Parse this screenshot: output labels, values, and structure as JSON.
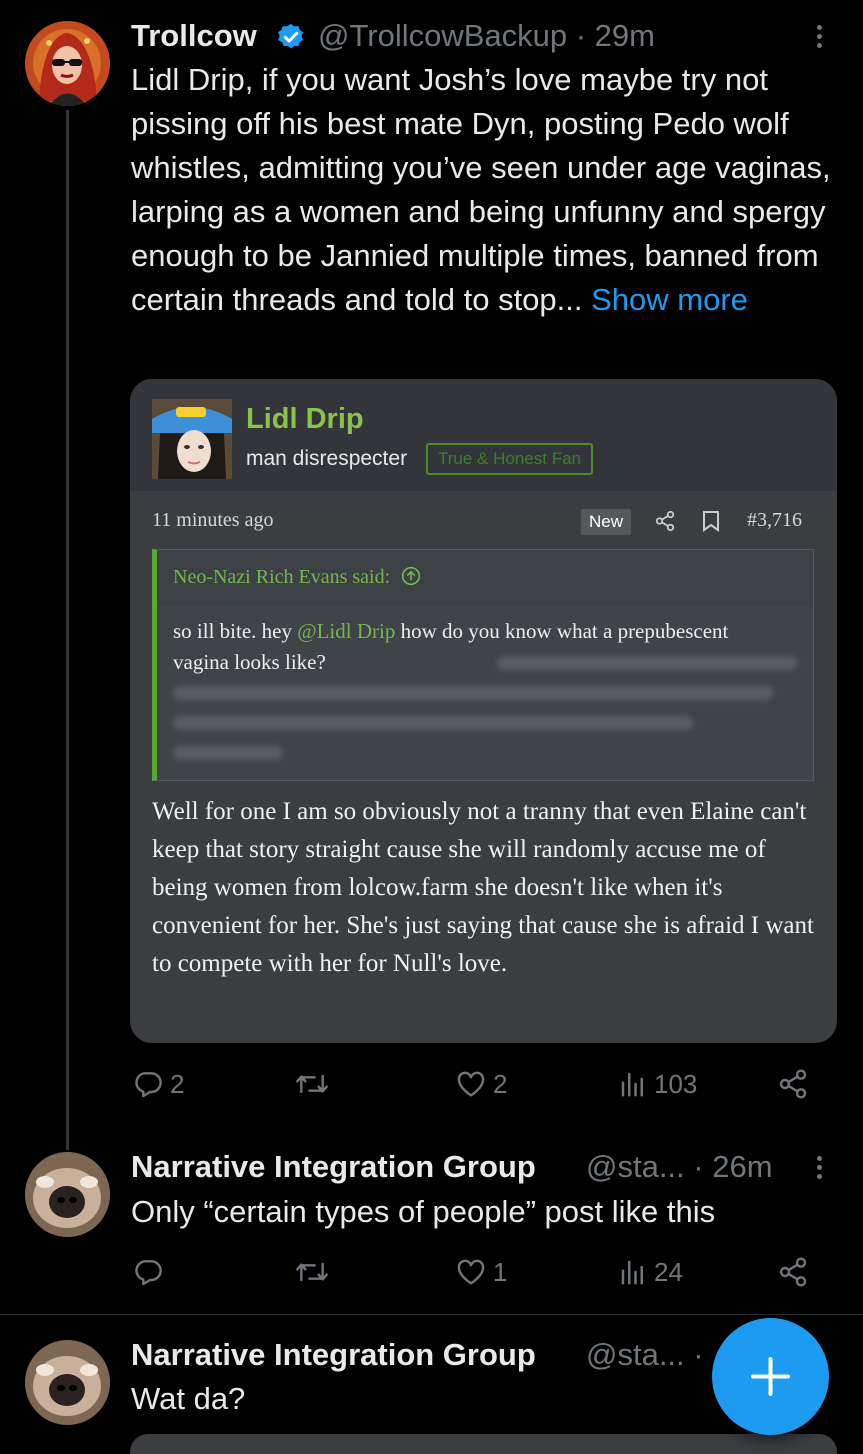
{
  "tweets": [
    {
      "name": "Trollcow",
      "handle": "@TrollcowBackup",
      "time": "· 29m",
      "text": "Lidl Drip, if you want Josh’s love maybe try not pissing off his best mate Dyn, posting Pedo wolf whistles, admitting you’ve seen under age vaginas, larping as a women and being unfunny and spergy enough to be Jannied multiple times, banned from certain threads and told to stop...",
      "show_more": "Show more",
      "stats": {
        "replies": "2",
        "likes": "2",
        "views": "103"
      }
    },
    {
      "name": "Narrative Integration Group",
      "handle": "@sta...",
      "time": "· 26m",
      "text": "Only “certain types of people” post like this",
      "stats": {
        "replies": "",
        "likes": "1",
        "views": "24"
      }
    },
    {
      "name": "Narrative Integration Group",
      "handle": "@sta...",
      "time": "·",
      "text": "Wat da?"
    }
  ],
  "embed": {
    "poster_name": "Lidl Drip",
    "poster_title": "man disrespecter",
    "poster_tag": "True & Honest Fan",
    "time": "11 minutes ago",
    "new_badge": "New",
    "post_number": "#3,716",
    "quote_attribution": "Neo-Nazi Rich Evans said:",
    "quote_text_before": "so ill bite. hey ",
    "quote_mention": "@Lidl Drip",
    "quote_text_after": " how do you know what a prepubescent vagina looks like?",
    "reply": "Well for one I am so obviously not a tranny that even Elaine can't keep that story straight cause she will randomly accuse me of being women from lolcow.farm she doesn't like when it's convenient for her. She's just saying that cause she is afraid I want to compete with her for Null's love."
  },
  "colors": {
    "accent": "#1d9bf0",
    "verified": "#1d9bf0",
    "forum_green": "#8bc34a"
  },
  "icons": [
    "verified-badge-icon",
    "more-icon",
    "reply-icon",
    "retweet-icon",
    "like-icon",
    "views-icon",
    "share-icon",
    "arrow-up-circle-icon",
    "plus-icon"
  ]
}
